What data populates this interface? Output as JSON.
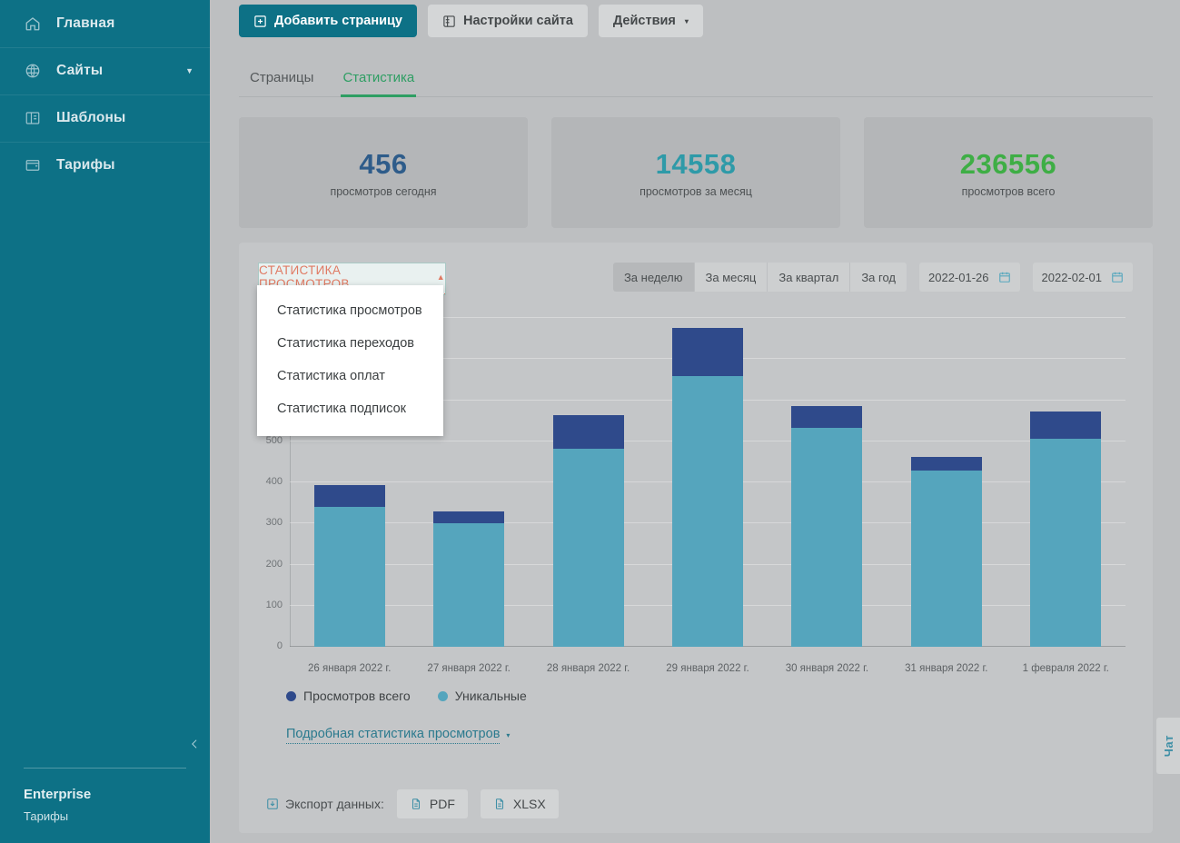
{
  "sidebar": {
    "items": [
      {
        "label": "Главная",
        "icon": "home-icon",
        "caret": false
      },
      {
        "label": "Сайты",
        "icon": "globe-icon",
        "caret": true
      },
      {
        "label": "Шаблоны",
        "icon": "template-icon",
        "caret": false
      },
      {
        "label": "Тарифы",
        "icon": "wallet-icon",
        "caret": false
      }
    ],
    "footer": {
      "plan": "Enterprise",
      "plan_label": "Тарифы"
    },
    "collapse_icon": "chevron-left-icon"
  },
  "toolbar": {
    "add_page": "Добавить страницу",
    "site_settings": "Настройки сайта",
    "actions": "Действия",
    "actions_caret": "▾"
  },
  "tabs": [
    {
      "label": "Страницы",
      "active": false
    },
    {
      "label": "Статистика",
      "active": true
    }
  ],
  "cards": [
    {
      "number": "456",
      "label": "просмотров сегодня",
      "color": "#2e5c8a"
    },
    {
      "number": "14558",
      "label": "просмотров за месяц",
      "color": "#2e9aa8"
    },
    {
      "number": "236556",
      "label": "просмотров всего",
      "color": "#3eae45"
    }
  ],
  "stat_select": {
    "current": "СТАТИСТИКА ПРОСМОТРОВ",
    "caret": "▲",
    "open": true,
    "options": [
      "Статистика просмотров",
      "Статистика переходов",
      "Статистика оплат",
      "Статистика подписок"
    ]
  },
  "filters": {
    "periods": [
      {
        "label": "За неделю",
        "active": true
      },
      {
        "label": "За месяц",
        "active": false
      },
      {
        "label": "За квартал",
        "active": false
      },
      {
        "label": "За год",
        "active": false
      }
    ],
    "date_from": "2022-01-26",
    "date_to": "2022-02-01",
    "calendar_icon": "calendar-icon"
  },
  "chart_data": {
    "type": "bar",
    "stacked": true,
    "title": "",
    "xlabel": "",
    "ylabel": "",
    "ylim": [
      0,
      800
    ],
    "yticks": [
      0,
      100,
      200,
      300,
      400,
      500
    ],
    "grid": true,
    "legend_position": "bottom-left",
    "categories": [
      "26 января 2022 г.",
      "27 января 2022 г.",
      "28 января 2022 г.",
      "29 января 2022 г.",
      "30 января 2022 г.",
      "31 января 2022 г.",
      "1 февраля 2022 г."
    ],
    "series": [
      {
        "name": "Уникальные",
        "color": "#55a5bd",
        "values": [
          340,
          300,
          482,
          658,
          532,
          428,
          507
        ]
      },
      {
        "name": "Просмотров всего",
        "color": "#2f4a8b",
        "values": [
          393,
          330,
          563,
          776,
          586,
          462,
          572
        ]
      }
    ]
  },
  "legend": [
    {
      "label": "Просмотров всего",
      "color": "#2f4a8b"
    },
    {
      "label": "Уникальные",
      "color": "#55a5bd"
    }
  ],
  "detail_link": {
    "label": "Подробная статистика просмотров",
    "caret": "▾"
  },
  "export": {
    "label": "Экспорт данных:",
    "icon": "download-icon",
    "buttons": [
      {
        "label": "PDF",
        "icon": "file-icon"
      },
      {
        "label": "XLSX",
        "icon": "file-icon"
      }
    ]
  },
  "chat_tab": {
    "label": "Чат"
  }
}
